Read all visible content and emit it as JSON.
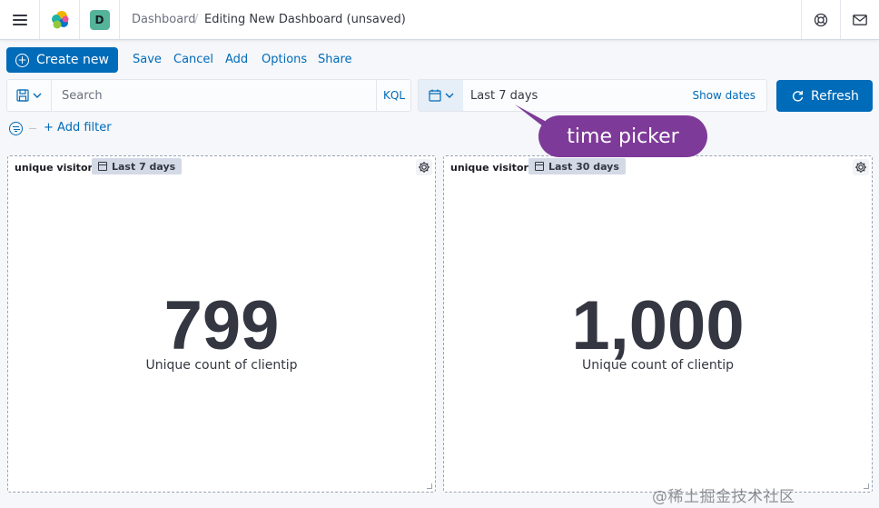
{
  "header": {
    "breadcrumb_root": "Dashboard",
    "breadcrumb_separator": "/",
    "breadcrumb_current": "Editing New Dashboard (unsaved)",
    "space_initial": "D",
    "space_color": "#54b399",
    "icons": [
      "menu-icon",
      "elastic-logo",
      "help-icon",
      "mail-icon"
    ]
  },
  "actions": {
    "create_new": "Create new",
    "save": "Save",
    "cancel": "Cancel",
    "add": "Add",
    "options": "Options",
    "share": "Share"
  },
  "query_bar": {
    "search_placeholder": "Search",
    "language": "KQL"
  },
  "date_picker": {
    "value": "Last 7 days",
    "show_dates": "Show dates"
  },
  "refresh_label": "Refresh",
  "filter": {
    "add_filter": "+ Add filter"
  },
  "callout": "time picker",
  "panels": [
    {
      "title": "unique visitors",
      "time_badge": "Last 7 days",
      "metric_value": "799",
      "metric_label": "Unique count of clientip"
    },
    {
      "title": "unique visitors",
      "time_badge": "Last 30 days",
      "metric_value": "1,000",
      "metric_label": "Unique count of clientip"
    }
  ],
  "watermark": "@稀土掘金技术社区",
  "colors": {
    "primary": "#006bb8",
    "callout": "#7e3a99",
    "page_bg": "#f5f7fa"
  }
}
